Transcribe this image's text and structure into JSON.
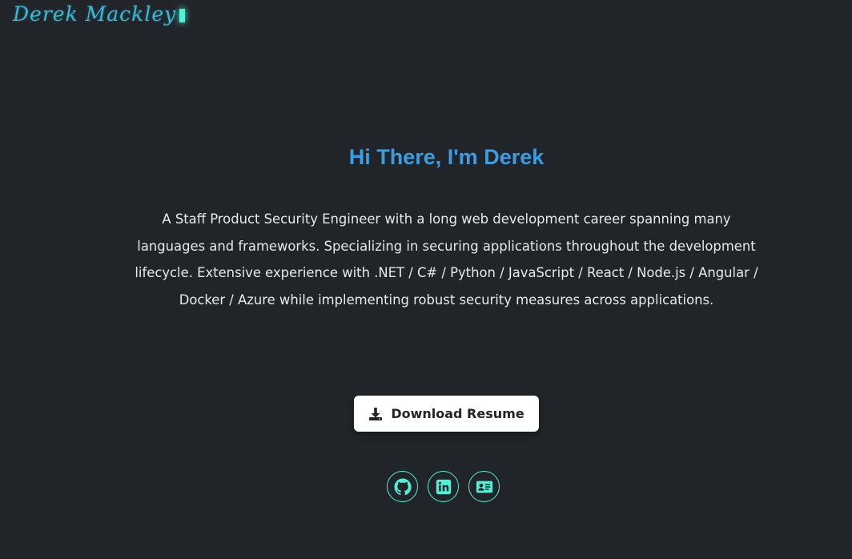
{
  "header": {
    "logo_text": "Derek Mackley"
  },
  "hero": {
    "title": "Hi There, I'm Derek",
    "description": "A Staff Product Security Engineer with a long web development career spanning many languages and frameworks. Specializing in securing applications throughout the development lifecycle. Extensive experience with .NET / C# / Python / JavaScript / React / Node.js / Angular / Docker / Azure while implementing robust security measures across applications.",
    "resume_button_label": "Download Resume"
  },
  "socials": [
    {
      "name": "GitHub",
      "icon": "github-icon"
    },
    {
      "name": "LinkedIn",
      "icon": "linkedin-icon"
    },
    {
      "name": "Contact Card",
      "icon": "id-card-icon"
    }
  ],
  "colors": {
    "background": "#212529",
    "title": "#3a9ee3",
    "accent": "#4ff0d5",
    "logo": "#3ab8d6",
    "text": "#e7e9ec"
  }
}
